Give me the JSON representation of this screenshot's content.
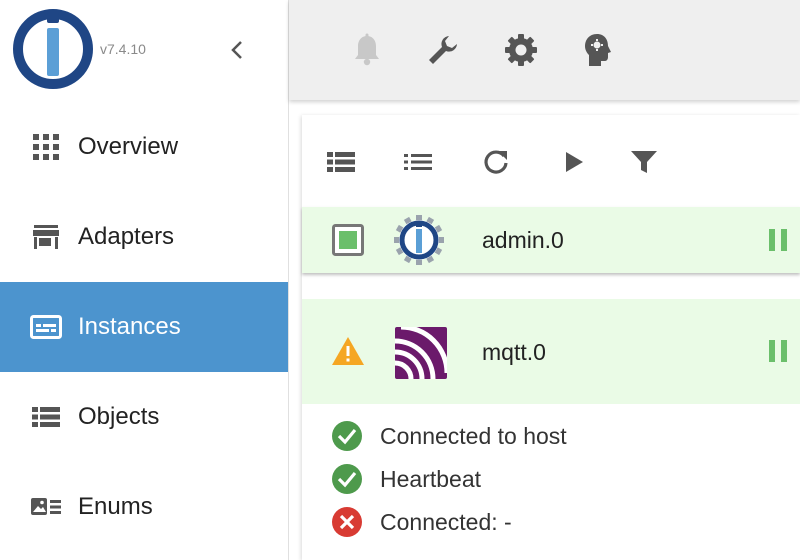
{
  "sidebar": {
    "version": "v7.4.10",
    "collapse_icon": "chevron-left-icon",
    "items": [
      {
        "label": "Overview",
        "icon": "grid-icon",
        "active": false
      },
      {
        "label": "Adapters",
        "icon": "store-icon",
        "active": false
      },
      {
        "label": "Instances",
        "icon": "instances-icon",
        "active": true
      },
      {
        "label": "Objects",
        "icon": "list-icon",
        "active": false
      },
      {
        "label": "Enums",
        "icon": "enums-icon",
        "active": false
      }
    ]
  },
  "topbar": {
    "icons": [
      "bell-icon",
      "wrench-icon",
      "gear-icon",
      "expert-head-icon"
    ]
  },
  "toolbar": {
    "icons": [
      "list-expanded-icon",
      "list-compact-icon",
      "refresh-icon",
      "play-icon",
      "filter-icon"
    ]
  },
  "instances": [
    {
      "name": "admin.0",
      "status": "running",
      "icon": "iobroker-admin-icon"
    },
    {
      "name": "mqtt.0",
      "status": "warning",
      "icon": "mqtt-icon"
    }
  ],
  "status_lines": [
    {
      "text": "Connected to host",
      "ok": true
    },
    {
      "text": "Heartbeat",
      "ok": true
    },
    {
      "text": "Connected: -",
      "ok": false
    }
  ],
  "colors": {
    "accent": "#4c94ce",
    "row_bg": "#eafbe6",
    "ok_green": "#4e9a4c",
    "error_red": "#d83b33",
    "warning_orange": "#f5a623",
    "mqtt_purple": "#6b1a6b",
    "logo_blue": "#2b4e8c"
  }
}
